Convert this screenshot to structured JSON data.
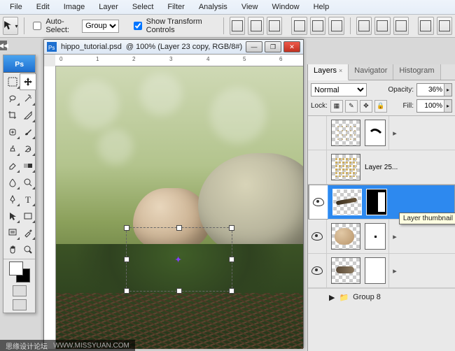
{
  "menu": [
    "File",
    "Edit",
    "Image",
    "Layer",
    "Select",
    "Filter",
    "Analysis",
    "View",
    "Window",
    "Help"
  ],
  "options": {
    "autoSelect_label": "Auto-Select:",
    "autoSelect_checked": false,
    "autoSelect_target": "Group",
    "showTransform_label": "Show Transform Controls",
    "showTransform_checked": true
  },
  "doc": {
    "filename": "hippo_tutorial.psd",
    "title_tail": " @ 100% (Layer 23 copy, RGB/8#)",
    "ruler_marks": [
      "0",
      "1",
      "2",
      "3",
      "4",
      "5",
      "6"
    ]
  },
  "layersPanel": {
    "tabs": [
      "Layers",
      "Navigator",
      "Histogram"
    ],
    "activeTab": 0,
    "blendMode": "Normal",
    "opacity_label": "Opacity:",
    "opacity_value": "36%",
    "lock_label": "Lock:",
    "fill_label": "Fill:",
    "fill_value": "100%",
    "tooltip": "Layer thumbnail",
    "layers": [
      {
        "visible": false,
        "name": "",
        "hasMask": true,
        "selected": false,
        "thumbStyle": "speckles",
        "maskStyle": "stroke"
      },
      {
        "visible": false,
        "name": "Layer 25...",
        "hasMask": false,
        "selected": false,
        "thumbStyle": "gold"
      },
      {
        "visible": true,
        "name": "",
        "hasMask": true,
        "selected": true,
        "thumbStyle": "twig",
        "maskStyle": "bw"
      },
      {
        "visible": true,
        "name": "",
        "hasMask": true,
        "selected": false,
        "thumbStyle": "egg",
        "maskStyle": "dot"
      },
      {
        "visible": true,
        "name": "",
        "hasMask": true,
        "selected": false,
        "thumbStyle": "feather",
        "maskStyle": "white"
      }
    ],
    "group": {
      "name": "Group 8"
    }
  },
  "watermark": {
    "a": "思缘设计论坛",
    "b": "WWW.MISSYUAN.COM"
  }
}
